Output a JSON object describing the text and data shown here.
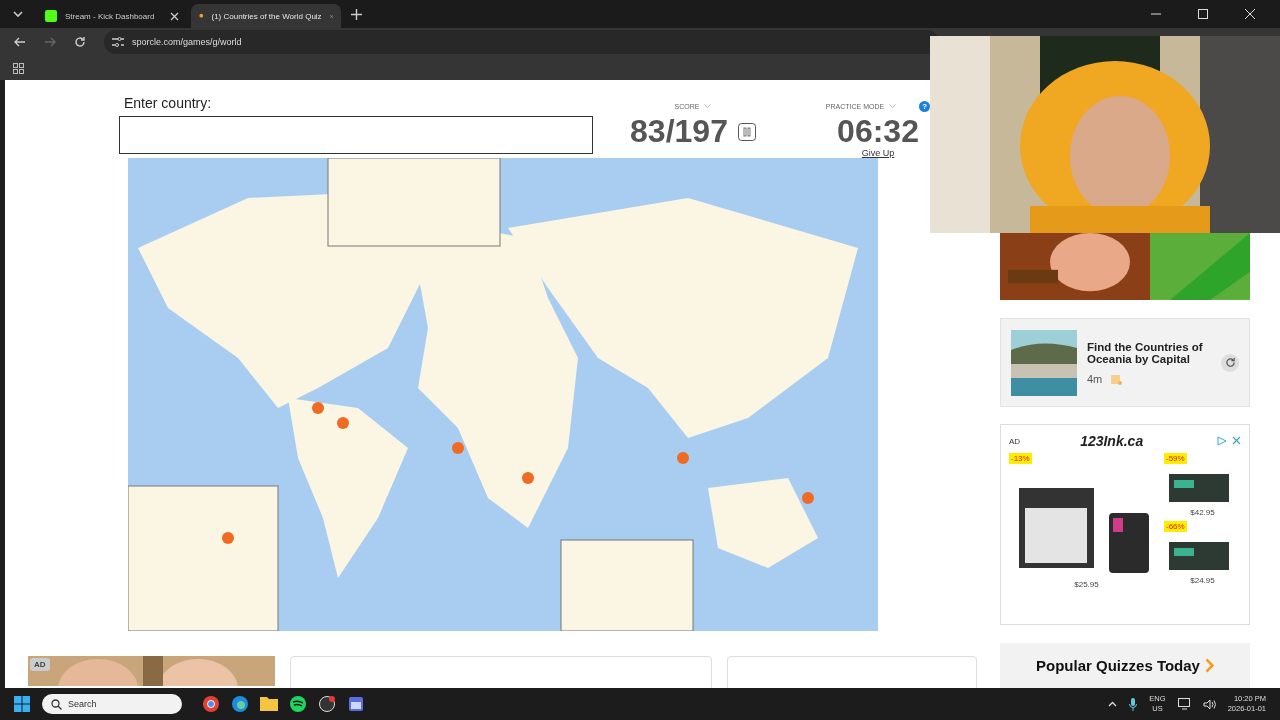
{
  "browser": {
    "tabs": [
      {
        "title": "Stream - Kick Dashboard",
        "kind": "kick",
        "selected": false
      },
      {
        "title": "(1) Countries of the World Quiz",
        "kind": "sporcle",
        "selected": true
      }
    ],
    "url": "sporcle.com/games/g/world"
  },
  "quiz": {
    "prompt": "Enter country:",
    "score_label": "SCORE",
    "score": "83/197",
    "mode_label": "PRACTICE MODE",
    "help": "?",
    "timer": "06:32",
    "give_up": "Give Up"
  },
  "sidebar": {
    "recommended": {
      "title": "Find the Countries of Oceania by Capital",
      "duration": "4m"
    },
    "ad": {
      "badge": "AD",
      "brand": "123Ink.ca",
      "products": [
        {
          "discount": "-13%",
          "price": "$25.95"
        },
        {
          "discount": "-59%",
          "price": "$42.95"
        },
        {
          "discount": "-66%",
          "price": "$24.95"
        }
      ]
    },
    "popular": "Popular Quizzes Today"
  },
  "bottom_ad": {
    "badge": "AD"
  },
  "taskbar": {
    "search_placeholder": "Search",
    "language": "ENG",
    "region": "US",
    "time": "10:20 PM",
    "date": "2026-01-01"
  }
}
